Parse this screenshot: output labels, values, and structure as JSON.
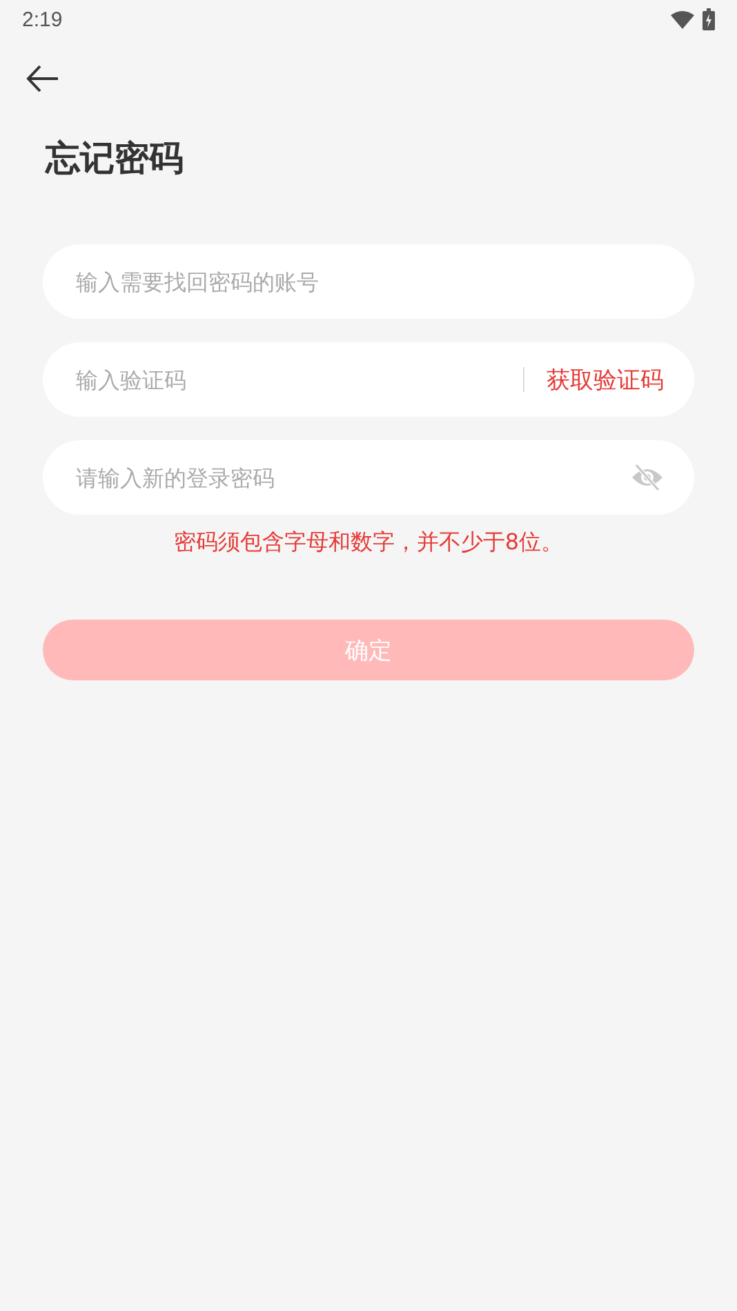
{
  "status_bar": {
    "time": "2:19"
  },
  "title": "忘记密码",
  "fields": [
    {
      "kind": "plain",
      "placeholder": "输入需要找回密码的账号"
    },
    {
      "kind": "code",
      "placeholder": "输入验证码",
      "action": "获取验证码"
    },
    {
      "kind": "password",
      "placeholder": "请输入新的登录密码"
    }
  ],
  "hint": "密码须包含字母和数字，并不少于8位。",
  "submit": {
    "label": "确定",
    "disabled": true
  }
}
